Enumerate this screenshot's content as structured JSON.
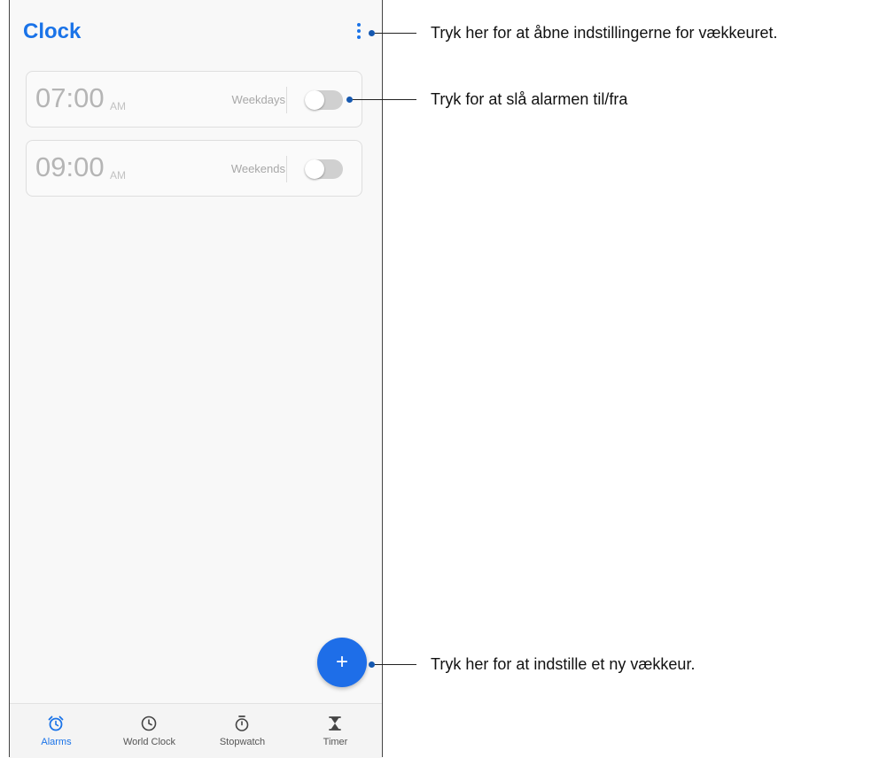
{
  "app": {
    "title": "Clock"
  },
  "alarms": [
    {
      "time": "07:00",
      "ampm": "AM",
      "days": "Weekdays",
      "enabled": false
    },
    {
      "time": "09:00",
      "ampm": "AM",
      "days": "Weekends",
      "enabled": false
    }
  ],
  "fab": {
    "icon": "plus-icon",
    "glyph": "+"
  },
  "nav": [
    {
      "label": "Alarms",
      "icon": "alarm-icon",
      "active": true
    },
    {
      "label": "World Clock",
      "icon": "clock-icon",
      "active": false
    },
    {
      "label": "Stopwatch",
      "icon": "stopwatch-icon",
      "active": false
    },
    {
      "label": "Timer",
      "icon": "hourglass-icon",
      "active": false
    }
  ],
  "callouts": [
    {
      "text": "Tryk her for at åbne indstillingerne for vækkeuret."
    },
    {
      "text": "Tryk for at slå alarmen til/fra"
    },
    {
      "text": "Tryk her for at indstille et ny vækkeur."
    }
  ],
  "colors": {
    "accent": "#1a73e8",
    "fab": "#1e6ee8",
    "callout_dot": "#1558b0"
  }
}
